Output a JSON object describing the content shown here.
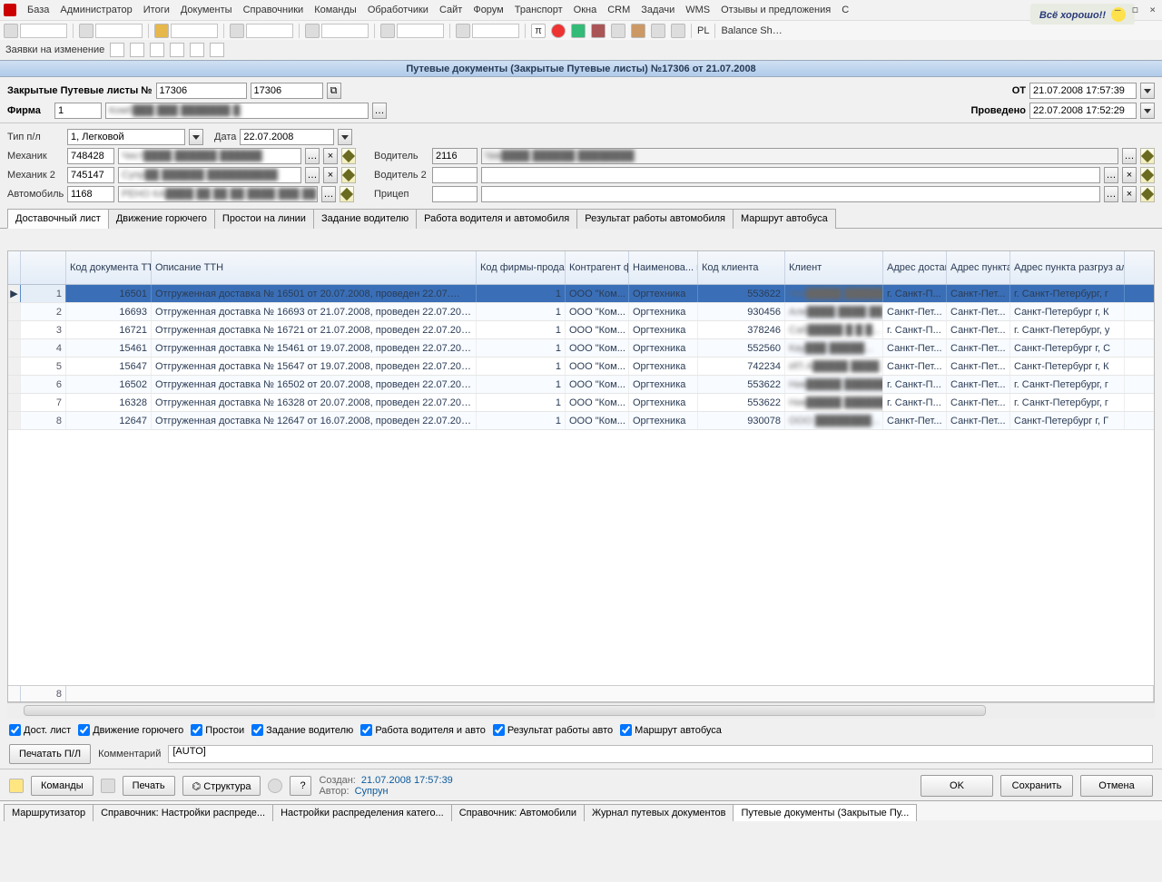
{
  "menu": [
    "База",
    "Администратор",
    "Итоги",
    "Документы",
    "Справочники",
    "Команды",
    "Обработчики",
    "Сайт",
    "Форум",
    "Транспорт",
    "Окна",
    "CRM",
    "Задачи",
    "WMS",
    "Отзывы и предложения",
    "C"
  ],
  "good_badge": "Всё хорошо!!",
  "toolbar2": {
    "PL": "PL",
    "Balance": "Balance Sh…"
  },
  "strip2_label": "Заявки на изменение",
  "titlebar": "Путевые документы (Закрытые Путевые листы) №17306 от 21.07.2008",
  "header": {
    "title_label": "Закрытые Путевые листы №",
    "num1": "17306",
    "num2": "17306",
    "ot_label": "OT",
    "ot_value": "21.07.2008 17:57:39",
    "firm_label": "Фирма",
    "firm_code": "1",
    "firm_name": "Комб███ ███ ███████ █",
    "prov_label": "Проведено",
    "prov_value": "22.07.2008 17:52:29"
  },
  "form": {
    "type_label": "Тип п/л",
    "type_value": "1, Легковой",
    "date_label": "Дата",
    "date_value": "22.07.2008",
    "mech_label": "Механик",
    "mech_code": "748428",
    "mech_name": "Чист████ ██████ ██████",
    "drv_label": "Водитель",
    "drv_code": "2116",
    "drv_name": "Чик████ ██████ ████████",
    "mech2_label": "Механик 2",
    "mech2_code": "745147",
    "mech2_name": "Супр██ ██████ ██████████",
    "drv2_label": "Водитель 2",
    "drv2_code": "",
    "drv2_name": "",
    "auto_label": "Автомобиль",
    "auto_code": "1168",
    "auto_name": "РЕНО КА████ ██ ██ ██ ████ ███ ██",
    "trailer_label": "Прицеп",
    "trailer_code": "",
    "trailer_name": ""
  },
  "tabs": [
    "Доставочный лист",
    "Движение горючего",
    "Простои на линии",
    "Задание водителю",
    "Работа водителя и автомобиля",
    "Результат работы автомобиля",
    "Маршрут автобуса"
  ],
  "grid": {
    "headers": {
      "n": "",
      "doc": "Код документа ТТН",
      "desc": "Описание ТТН",
      "firm": "Код фирмы-продавца",
      "contr": "Контрагент фирмы-пр...",
      "cargo": "Наименова... груза",
      "ccode": "Код клиента",
      "client": "Клиент",
      "addr": "Адрес доставки",
      "load": "Адрес пункта погрузки",
      "unload": "Адрес пункта разгруз альтернативный"
    },
    "rows": [
      {
        "n": "1",
        "doc": "16501",
        "desc": "Отгруженная доставка № 16501 от 20.07.2008, проведен 22.07.…",
        "firm": "1",
        "contr": "ООО \"Ком...",
        "cargo": "Оргтехника",
        "ccode": "553622",
        "client": "Ник█████ ██████...",
        "addr": "г. Санкт-П...",
        "load": "Санкт-Пет...",
        "unload": "г. Санкт-Петербург, г"
      },
      {
        "n": "2",
        "doc": "16693",
        "desc": "Отгруженная доставка № 16693 от 21.07.2008, проведен 22.07.20…",
        "firm": "1",
        "contr": "ООО \"Ком...",
        "cargo": "Оргтехника",
        "ccode": "930456",
        "client": "Але████ ████ ██...",
        "addr": "Санкт-Пет...",
        "load": "Санкт-Пет...",
        "unload": "Санкт-Петербург г, К"
      },
      {
        "n": "3",
        "doc": "16721",
        "desc": "Отгруженная доставка № 16721 от 21.07.2008, проведен 22.07.20…",
        "firm": "1",
        "contr": "ООО \"Ком...",
        "cargo": "Оргтехника",
        "ccode": "378246",
        "client": "Саб█████ █ █ █...",
        "addr": "г. Санкт-П...",
        "load": "Санкт-Пет...",
        "unload": "г. Санкт-Петербург, у"
      },
      {
        "n": "4",
        "doc": "15461",
        "desc": "Отгруженная доставка № 15461 от 19.07.2008, проведен 22.07.20…",
        "firm": "1",
        "contr": "ООО \"Ком...",
        "cargo": "Оргтехника",
        "ccode": "552560",
        "client": "Кау███ █████...",
        "addr": "Санкт-Пет...",
        "load": "Санкт-Пет...",
        "unload": "Санкт-Петербург г, С"
      },
      {
        "n": "5",
        "doc": "15647",
        "desc": "Отгруженная доставка № 15647 от 19.07.2008, проведен 22.07.20…",
        "firm": "1",
        "contr": "ООО \"Ком...",
        "cargo": "Оргтехника",
        "ccode": "742234",
        "client": "ИП А█████ ████ ...",
        "addr": "Санкт-Пет...",
        "load": "Санкт-Пет...",
        "unload": "Санкт-Петербург г, К"
      },
      {
        "n": "6",
        "doc": "16502",
        "desc": "Отгруженная доставка № 16502 от 20.07.2008, проведен 22.07.20…",
        "firm": "1",
        "contr": "ООО \"Ком...",
        "cargo": "Оргтехника",
        "ccode": "553622",
        "client": "Ник█████ ██████...",
        "addr": "г. Санкт-П...",
        "load": "Санкт-Пет...",
        "unload": "г. Санкт-Петербург, г"
      },
      {
        "n": "7",
        "doc": "16328",
        "desc": "Отгруженная доставка № 16328 от 20.07.2008, проведен 22.07.20…",
        "firm": "1",
        "contr": "ООО \"Ком...",
        "cargo": "Оргтехника",
        "ccode": "553622",
        "client": "Ник█████ ██████...",
        "addr": "г. Санкт-П...",
        "load": "Санкт-Пет...",
        "unload": "г. Санкт-Петербург, г"
      },
      {
        "n": "8",
        "doc": "12647",
        "desc": "Отгруженная доставка № 12647 от 16.07.2008, проведен 22.07.20…",
        "firm": "1",
        "contr": "ООО \"Ком...",
        "cargo": "Оргтехника",
        "ccode": "930078",
        "client": "ООО ████████...",
        "addr": "Санкт-Пет...",
        "load": "Санкт-Пет...",
        "unload": "Санкт-Петербург г, Г"
      }
    ],
    "footer_count": "8"
  },
  "checks": [
    "Дост. лист",
    "Движение горючего",
    "Простои",
    "Задание водителю",
    "Работа водителя и авто",
    "Результат работы авто",
    "Маршрут автобуса"
  ],
  "print_btn": "Печатать П/Л",
  "comment_label": "Комментарий",
  "comment_value": "[AUTO]",
  "bottom": {
    "cmds": "Команды",
    "print": "Печать",
    "struct": "Структура",
    "created_k": "Создан:",
    "created_v": "21.07.2008 17:57:39",
    "author_k": "Автор:",
    "author_v": "Супрун",
    "ok": "OK",
    "save": "Сохранить",
    "cancel": "Отмена"
  },
  "bottom_tabs": [
    "Маршрутизатор",
    "Справочник: Настройки распреде...",
    "Настройки распределения катего...",
    "Справочник: Автомобили",
    "Журнал путевых документов",
    "Путевые документы (Закрытые Пу..."
  ]
}
